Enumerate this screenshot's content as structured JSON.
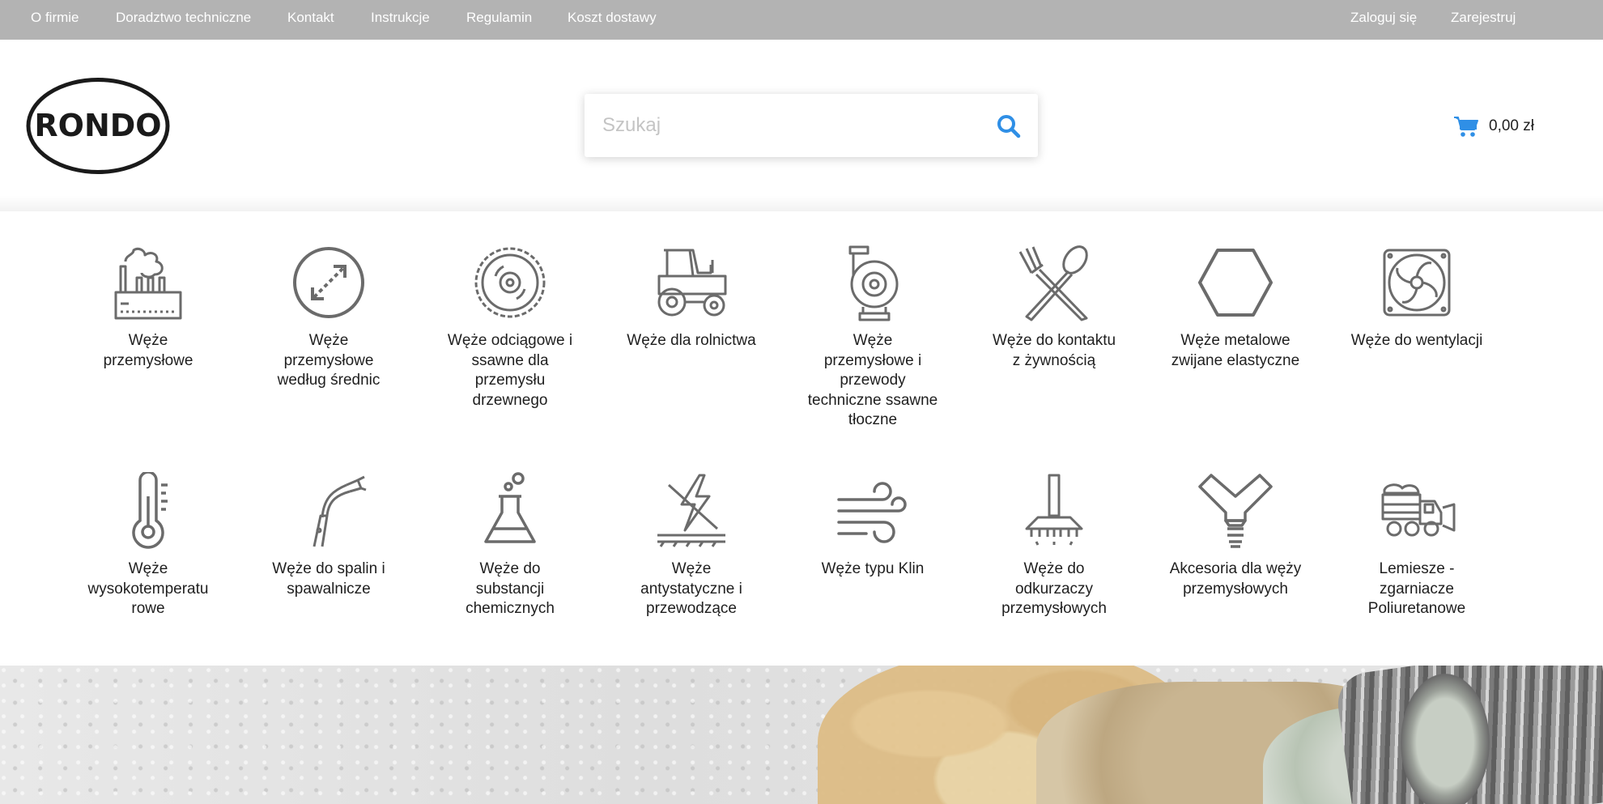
{
  "topbar": {
    "links": [
      {
        "label": "O firmie"
      },
      {
        "label": "Doradztwo techniczne"
      },
      {
        "label": "Kontakt"
      },
      {
        "label": "Instrukcje"
      },
      {
        "label": "Regulamin"
      },
      {
        "label": "Koszt dostawy"
      }
    ],
    "login": "Zaloguj się",
    "register": "Zarejestruj"
  },
  "header": {
    "logo_text": "RONDO",
    "search": {
      "placeholder": "Szukaj",
      "value": "",
      "icon": "search-icon"
    },
    "cart": {
      "total": "0,00 zł",
      "icon": "cart-icon"
    }
  },
  "categories": [
    {
      "label": "Węże przemysłowe",
      "icon": "factory-icon"
    },
    {
      "label": "Węże przemysłowe według średnic",
      "icon": "diameter-icon"
    },
    {
      "label": "Węże odciągowe i ssawne dla przemysłu drzewnego",
      "icon": "saw-blade-icon"
    },
    {
      "label": "Węże dla rolnictwa",
      "icon": "tractor-icon"
    },
    {
      "label": "Węże przemysłowe i przewody techniczne ssawne tłoczne",
      "icon": "pump-icon"
    },
    {
      "label": "Węże do kontaktu z żywnością",
      "icon": "fork-spoon-icon"
    },
    {
      "label": "Węże metalowe zwijane elastyczne",
      "icon": "hexagon-icon"
    },
    {
      "label": "Węże do wentylacji",
      "icon": "fan-icon"
    },
    {
      "label": "Węże wysokotemperatu rowe",
      "icon": "thermometer-icon"
    },
    {
      "label": "Węże do spalin i spawalnicze",
      "icon": "welding-torch-icon"
    },
    {
      "label": "Węże do substancji chemicznych",
      "icon": "flask-icon"
    },
    {
      "label": "Węże antystatyczne i przewodzące",
      "icon": "antistatic-icon"
    },
    {
      "label": "Węże typu Klin",
      "icon": "wind-icon"
    },
    {
      "label": "Węże do odkurzaczy przemysłowych",
      "icon": "vacuum-brush-icon"
    },
    {
      "label": "Akcesoria dla węży przemysłowych",
      "icon": "y-connector-icon"
    },
    {
      "label": "Lemiesze - zgarniacze Poliuretanowe",
      "icon": "snowplow-truck-icon"
    }
  ],
  "colors": {
    "topbar_bg": "#b3b3b3",
    "accent": "#2f8fe6",
    "icon_stroke": "#6b6b6b",
    "text": "#1f1f1f"
  }
}
